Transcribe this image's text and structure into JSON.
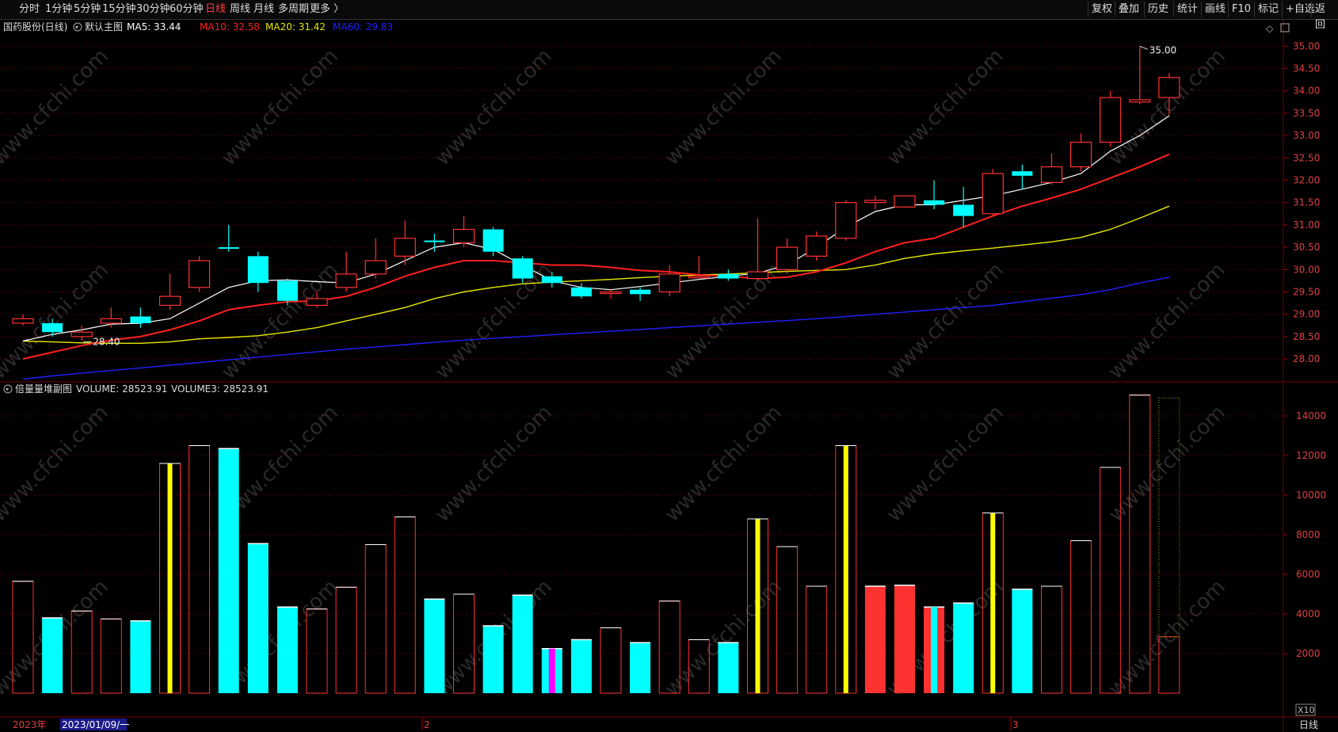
{
  "toolbar": {
    "left_items": [
      "分时",
      "1分钟",
      "5分钟",
      "15分钟",
      "30分钟",
      "60分钟",
      "日线",
      "周线",
      "月线",
      "多周期",
      "更多 〉"
    ],
    "active_index": 6,
    "right_items": [
      "复权",
      "叠加",
      "历史",
      "统计",
      "画线",
      "F10",
      "标记",
      "+自选",
      "返回"
    ]
  },
  "main_legend": {
    "stock": "国药股份(日线)",
    "template": "默认主图",
    "items": [
      {
        "label": "MA5: 33.44",
        "color": "#ffffff"
      },
      {
        "label": "MA10: 32.58",
        "color": "#ff2020"
      },
      {
        "label": "MA20: 31.42",
        "color": "#e8e800"
      },
      {
        "label": "MA60: 29.83",
        "color": "#2020ff"
      }
    ]
  },
  "sub_legend": {
    "title": "倍量量堆副图",
    "items": [
      {
        "label": "VOLUME: 28523.91",
        "color": "#dddddd"
      },
      {
        "label": "VOLUME3: 28523.91",
        "color": "#dddddd"
      }
    ]
  },
  "annotations": {
    "high_label": "35.00",
    "low_label": "28.40"
  },
  "price_axis": [
    "35.00",
    "34.50",
    "34.00",
    "33.50",
    "33.00",
    "32.50",
    "32.00",
    "31.50",
    "31.00",
    "30.50",
    "30.00",
    "29.50",
    "29.00",
    "28.50",
    "28.00"
  ],
  "volume_axis": [
    "14000",
    "12000",
    "10000",
    "8000",
    "6000",
    "4000",
    "2000"
  ],
  "volume_unit": "X10",
  "bottom_bar": {
    "year": "2023年",
    "cursor_date": "2023/01/09/一",
    "month_marks": [
      "2",
      "3"
    ],
    "period_label": "日线"
  },
  "watermark": "www.cfchi.com",
  "colors": {
    "up": "#ff3232",
    "down": "#00ffff",
    "ma5": "#ffffff",
    "ma10": "#ff2020",
    "ma20": "#e8e800",
    "ma60": "#2020ff",
    "bg": "#000000",
    "grid": "#5a0000"
  },
  "chart_data": {
    "type": "candlestick",
    "price_range": [
      27.7,
      35.2
    ],
    "volume_range": [
      0,
      15000
    ],
    "candles": [
      {
        "o": 28.8,
        "c": 28.9,
        "h": 29.0,
        "l": 28.75,
        "dir": "up"
      },
      {
        "o": 28.8,
        "c": 28.6,
        "h": 28.9,
        "l": 28.5,
        "dir": "down"
      },
      {
        "o": 28.6,
        "c": 28.5,
        "h": 28.75,
        "l": 28.4,
        "dir": "up"
      },
      {
        "o": 28.8,
        "c": 28.9,
        "h": 29.15,
        "l": 28.7,
        "dir": "up"
      },
      {
        "o": 28.95,
        "c": 28.8,
        "h": 29.15,
        "l": 28.7,
        "dir": "down"
      },
      {
        "o": 29.2,
        "c": 29.4,
        "h": 29.9,
        "l": 29.1,
        "dir": "up"
      },
      {
        "o": 29.6,
        "c": 30.2,
        "h": 30.3,
        "l": 29.5,
        "dir": "up"
      },
      {
        "o": 30.5,
        "c": 30.5,
        "h": 31.0,
        "l": 30.4,
        "dir": "down"
      },
      {
        "o": 30.3,
        "c": 29.7,
        "h": 30.4,
        "l": 29.5,
        "dir": "down"
      },
      {
        "o": 29.75,
        "c": 29.3,
        "h": 29.8,
        "l": 29.2,
        "dir": "down"
      },
      {
        "o": 29.2,
        "c": 29.35,
        "h": 29.5,
        "l": 29.15,
        "dir": "up"
      },
      {
        "o": 29.6,
        "c": 29.9,
        "h": 30.4,
        "l": 29.5,
        "dir": "up"
      },
      {
        "o": 29.9,
        "c": 30.2,
        "h": 30.7,
        "l": 29.8,
        "dir": "up"
      },
      {
        "o": 30.3,
        "c": 30.7,
        "h": 31.1,
        "l": 30.1,
        "dir": "up"
      },
      {
        "o": 30.65,
        "c": 30.65,
        "h": 30.8,
        "l": 30.4,
        "dir": "down"
      },
      {
        "o": 30.6,
        "c": 30.9,
        "h": 31.2,
        "l": 30.5,
        "dir": "up"
      },
      {
        "o": 30.9,
        "c": 30.4,
        "h": 30.95,
        "l": 30.3,
        "dir": "down"
      },
      {
        "o": 30.25,
        "c": 29.8,
        "h": 30.3,
        "l": 29.7,
        "dir": "down"
      },
      {
        "o": 29.85,
        "c": 29.7,
        "h": 29.95,
        "l": 29.6,
        "dir": "down"
      },
      {
        "o": 29.6,
        "c": 29.4,
        "h": 29.7,
        "l": 29.35,
        "dir": "down"
      },
      {
        "o": 29.5,
        "c": 29.5,
        "h": 29.55,
        "l": 29.35,
        "dir": "up"
      },
      {
        "o": 29.55,
        "c": 29.45,
        "h": 29.6,
        "l": 29.3,
        "dir": "down"
      },
      {
        "o": 29.5,
        "c": 29.9,
        "h": 30.1,
        "l": 29.4,
        "dir": "up"
      },
      {
        "o": 29.85,
        "c": 29.85,
        "h": 30.3,
        "l": 29.8,
        "dir": "up"
      },
      {
        "o": 29.9,
        "c": 29.8,
        "h": 30.0,
        "l": 29.75,
        "dir": "down"
      },
      {
        "o": 29.8,
        "c": 29.95,
        "h": 31.15,
        "l": 29.75,
        "dir": "up"
      },
      {
        "o": 30.0,
        "c": 30.5,
        "h": 30.7,
        "l": 29.9,
        "dir": "up"
      },
      {
        "o": 30.3,
        "c": 30.75,
        "h": 30.85,
        "l": 30.2,
        "dir": "up"
      },
      {
        "o": 30.7,
        "c": 31.5,
        "h": 31.55,
        "l": 30.65,
        "dir": "up"
      },
      {
        "o": 31.5,
        "c": 31.55,
        "h": 31.65,
        "l": 31.35,
        "dir": "up"
      },
      {
        "o": 31.4,
        "c": 31.65,
        "h": 31.65,
        "l": 31.4,
        "dir": "up"
      },
      {
        "o": 31.55,
        "c": 31.45,
        "h": 32.0,
        "l": 31.35,
        "dir": "down"
      },
      {
        "o": 31.45,
        "c": 31.2,
        "h": 31.85,
        "l": 30.95,
        "dir": "down"
      },
      {
        "o": 31.25,
        "c": 32.15,
        "h": 32.25,
        "l": 31.2,
        "dir": "up"
      },
      {
        "o": 32.2,
        "c": 32.1,
        "h": 32.35,
        "l": 31.8,
        "dir": "down"
      },
      {
        "o": 31.95,
        "c": 32.3,
        "h": 32.6,
        "l": 31.9,
        "dir": "up"
      },
      {
        "o": 32.3,
        "c": 32.85,
        "h": 33.05,
        "l": 32.2,
        "dir": "up"
      },
      {
        "o": 32.85,
        "c": 33.85,
        "h": 34.0,
        "l": 32.75,
        "dir": "up"
      },
      {
        "o": 33.75,
        "c": 33.8,
        "h": 35.0,
        "l": 33.7,
        "dir": "up"
      },
      {
        "o": 33.85,
        "c": 34.3,
        "h": 34.4,
        "l": 33.45,
        "dir": "up"
      }
    ],
    "volume": [
      5650,
      3800,
      4150,
      3750,
      3650,
      11600,
      12500,
      12350,
      7550,
      4350,
      4250,
      5350,
      7500,
      8900,
      4750,
      5000,
      3400,
      4950,
      2250,
      2700,
      3300,
      2550,
      4650,
      2700,
      2550,
      8800,
      7400,
      5400,
      12500,
      5400,
      5450,
      4350,
      4550,
      9100,
      5250,
      5400,
      7700,
      11400,
      15050,
      2850
    ],
    "volume_style": [
      "hollow",
      "fill-cyan",
      "hollow",
      "hollow",
      "fill-cyan",
      "hollow-yellow",
      "hollow",
      "fill-cyan",
      "fill-cyan",
      "fill-cyan",
      "hollow",
      "hollow",
      "hollow",
      "hollow",
      "fill-cyan",
      "hollow",
      "fill-cyan",
      "fill-cyan",
      "fill-cyan-magenta",
      "fill-cyan",
      "hollow",
      "fill-cyan",
      "hollow",
      "hollow",
      "fill-cyan",
      "hollow-yellow",
      "hollow",
      "hollow",
      "hollow-yellow",
      "fill-red",
      "fill-red",
      "fill-red-cyan",
      "fill-cyan",
      "hollow-yellow",
      "fill-cyan",
      "hollow",
      "hollow",
      "hollow",
      "hollow",
      "hollow-dotted"
    ],
    "ma5": [
      28.4,
      28.55,
      28.65,
      28.78,
      28.8,
      28.9,
      29.25,
      29.6,
      29.75,
      29.77,
      29.73,
      29.7,
      29.9,
      30.2,
      30.5,
      30.6,
      30.45,
      30.1,
      29.75,
      29.6,
      29.55,
      29.62,
      29.7,
      29.78,
      29.85,
      29.92,
      30.1,
      30.5,
      30.95,
      31.3,
      31.45,
      31.45,
      31.55,
      31.65,
      31.8,
      31.95,
      32.15,
      32.65,
      33.0,
      33.44
    ],
    "ma10": [
      28.0,
      28.15,
      28.3,
      28.42,
      28.5,
      28.65,
      28.85,
      29.1,
      29.2,
      29.28,
      29.3,
      29.4,
      29.6,
      29.85,
      30.05,
      30.2,
      30.2,
      30.15,
      30.1,
      30.1,
      30.05,
      29.98,
      29.95,
      29.88,
      29.85,
      29.8,
      29.83,
      29.95,
      30.15,
      30.4,
      30.6,
      30.7,
      30.95,
      31.2,
      31.42,
      31.6,
      31.8,
      32.05,
      32.3,
      32.58
    ],
    "ma20": [
      28.4,
      28.38,
      28.36,
      28.35,
      28.35,
      28.38,
      28.45,
      28.48,
      28.52,
      28.6,
      28.7,
      28.85,
      29.0,
      29.15,
      29.35,
      29.5,
      29.6,
      29.68,
      29.72,
      29.75,
      29.78,
      29.82,
      29.85,
      29.88,
      29.9,
      29.93,
      29.96,
      29.98,
      30.0,
      30.1,
      30.25,
      30.35,
      30.42,
      30.48,
      30.55,
      30.62,
      30.72,
      30.9,
      31.15,
      31.42
    ],
    "ma60": [
      27.55,
      27.62,
      27.68,
      27.74,
      27.8,
      27.86,
      27.92,
      27.98,
      28.04,
      28.1,
      28.16,
      28.22,
      28.27,
      28.32,
      28.37,
      28.42,
      28.46,
      28.5,
      28.54,
      28.58,
      28.62,
      28.66,
      28.7,
      28.74,
      28.78,
      28.82,
      28.86,
      28.9,
      28.95,
      29.0,
      29.05,
      29.1,
      29.15,
      29.2,
      29.28,
      29.36,
      29.44,
      29.55,
      29.7,
      29.83
    ]
  }
}
